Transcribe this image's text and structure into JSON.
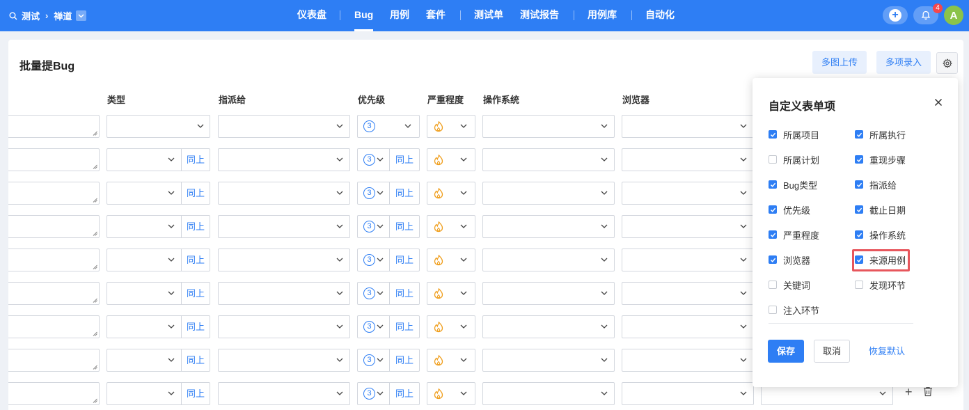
{
  "header": {
    "search_icon": "search-icon",
    "breadcrumb": [
      "测试",
      "禅道"
    ],
    "nav": [
      "仪表盘",
      "Bug",
      "用例",
      "套件",
      "测试单",
      "测试报告",
      "用例库",
      "自动化"
    ],
    "active_nav": "Bug",
    "notification_count": "4",
    "avatar_letter": "A",
    "accent": "#2e7ef4"
  },
  "page": {
    "title": "批量提Bug",
    "multi_image_upload": "多图上传",
    "multi_entry": "多项录入"
  },
  "columns": [
    "类型",
    "指派给",
    "优先级",
    "严重程度",
    "操作系统",
    "浏览器"
  ],
  "rows": {
    "same_as_above": "同上",
    "priority_value": "3"
  },
  "popup": {
    "title": "自定义表单项",
    "options": [
      {
        "label": "所属项目",
        "checked": true
      },
      {
        "label": "所属执行",
        "checked": true
      },
      {
        "label": "所属计划",
        "checked": false
      },
      {
        "label": "重现步骤",
        "checked": true
      },
      {
        "label": "Bug类型",
        "checked": true
      },
      {
        "label": "指派给",
        "checked": true
      },
      {
        "label": "优先级",
        "checked": true
      },
      {
        "label": "截止日期",
        "checked": true
      },
      {
        "label": "严重程度",
        "checked": true
      },
      {
        "label": "操作系统",
        "checked": true
      },
      {
        "label": "浏览器",
        "checked": true
      },
      {
        "label": "来源用例",
        "checked": true
      },
      {
        "label": "关键词",
        "checked": false
      },
      {
        "label": "发现环节",
        "checked": false
      },
      {
        "label": "注入环节",
        "checked": false
      }
    ],
    "save": "保存",
    "cancel": "取消",
    "reset": "恢复默认"
  }
}
